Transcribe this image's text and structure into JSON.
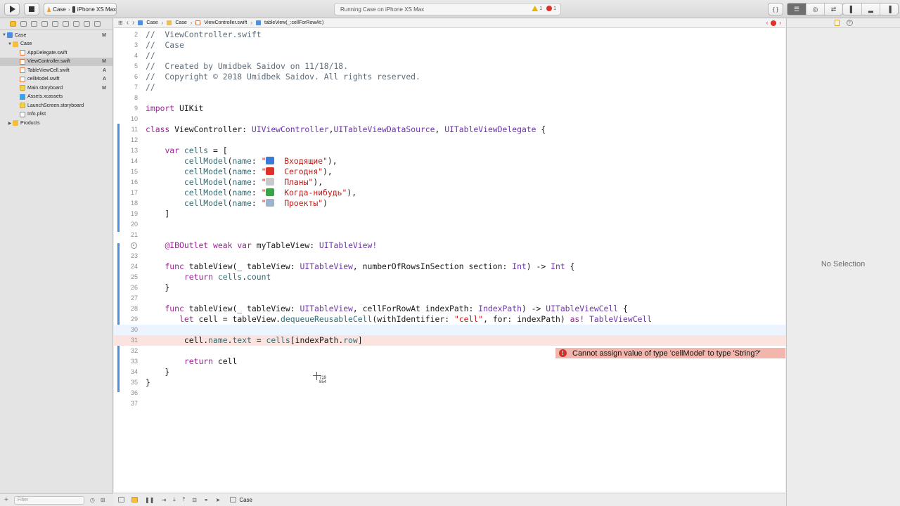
{
  "toolbar": {
    "scheme": "Case",
    "device": "iPhone XS Max",
    "activity": "Running Case on iPhone XS Max",
    "warnings": "1",
    "errors": "1",
    "library_glyph": "{ }"
  },
  "navigator": {
    "items": [
      {
        "label": "Case",
        "status": "M"
      },
      {
        "label": "Case",
        "status": ""
      },
      {
        "label": "AppDelegate.swift",
        "status": ""
      },
      {
        "label": "ViewController.swift",
        "status": "M"
      },
      {
        "label": "TableViewCell.swift",
        "status": "A"
      },
      {
        "label": "cellModel.swift",
        "status": "A"
      },
      {
        "label": "Main.storyboard",
        "status": "M"
      },
      {
        "label": "Assets.xcassets",
        "status": ""
      },
      {
        "label": "LaunchScreen.storyboard",
        "status": ""
      },
      {
        "label": "Info.plist",
        "status": ""
      },
      {
        "label": "Products",
        "status": ""
      }
    ],
    "filter_placeholder": "Filter"
  },
  "jumpbar": {
    "crumbs": [
      "Case",
      "Case",
      "ViewController.swift",
      "tableView(_:cellForRowAt:)"
    ]
  },
  "editor": {
    "line_numbers": [
      "2",
      "3",
      "4",
      "5",
      "6",
      "7",
      "8",
      "9",
      "10",
      "11",
      "12",
      "13",
      "14",
      "15",
      "16",
      "17",
      "18",
      "19",
      "20",
      "21",
      "22",
      "23",
      "24",
      "25",
      "26",
      "27",
      "28",
      "29",
      "30",
      "31",
      "32",
      "33",
      "34",
      "35",
      "36",
      "37"
    ],
    "lines": [
      "//  ViewController.swift",
      "//  Case",
      "//",
      "//  Created by Umidbek Saidov on 11/18/18.",
      "//  Copyright © 2018 Umidbek Saidov. All rights reserved.",
      "//",
      "",
      "import UIKit",
      "",
      "class ViewController: UIViewController,UITableViewDataSource, UITableViewDelegate {",
      "",
      "    var cells = [",
      "        cellModel(name: \"📥  Входящие\"),",
      "        cellModel(name: \"⭕  Сегодня\"),",
      "        cellModel(name: \"📆  Планы\"),",
      "        cellModel(name: \"📗  Когда-нибудь\"),",
      "        cellModel(name: \"📂  Проекты\")",
      "    ]",
      "",
      "",
      "    @IBOutlet weak var myTableView: UITableView!",
      "",
      "    func tableView(_ tableView: UITableView, numberOfRowsInSection section: Int) -> Int {",
      "        return cells.count",
      "    }",
      "",
      "    func tableView(_ tableView: UITableView, cellForRowAt indexPath: IndexPath) -> UITableViewCell {",
      "       let cell = tableView.dequeueReusableCell(withIdentifier: \"cell\", for: indexPath) as! TableViewCell",
      "",
      "        cell.name.text = cells[indexPath.row]",
      "",
      "        return cell",
      "    }",
      "}",
      "",
      ""
    ],
    "error_message": "Cannot assign value of type 'cellModel' to type 'String?'",
    "cursor_x": "719",
    "cursor_y": "854"
  },
  "debug_bar": {
    "target": "Case"
  },
  "inspector": {
    "empty_label": "No Selection"
  },
  "colors": {
    "keyword": "#9b2393",
    "comment": "#5d6c79",
    "type": "#6c36a9",
    "string": "#c41a16",
    "error_banner": "#f2b6ac",
    "change_bar": "#4a90e2"
  }
}
